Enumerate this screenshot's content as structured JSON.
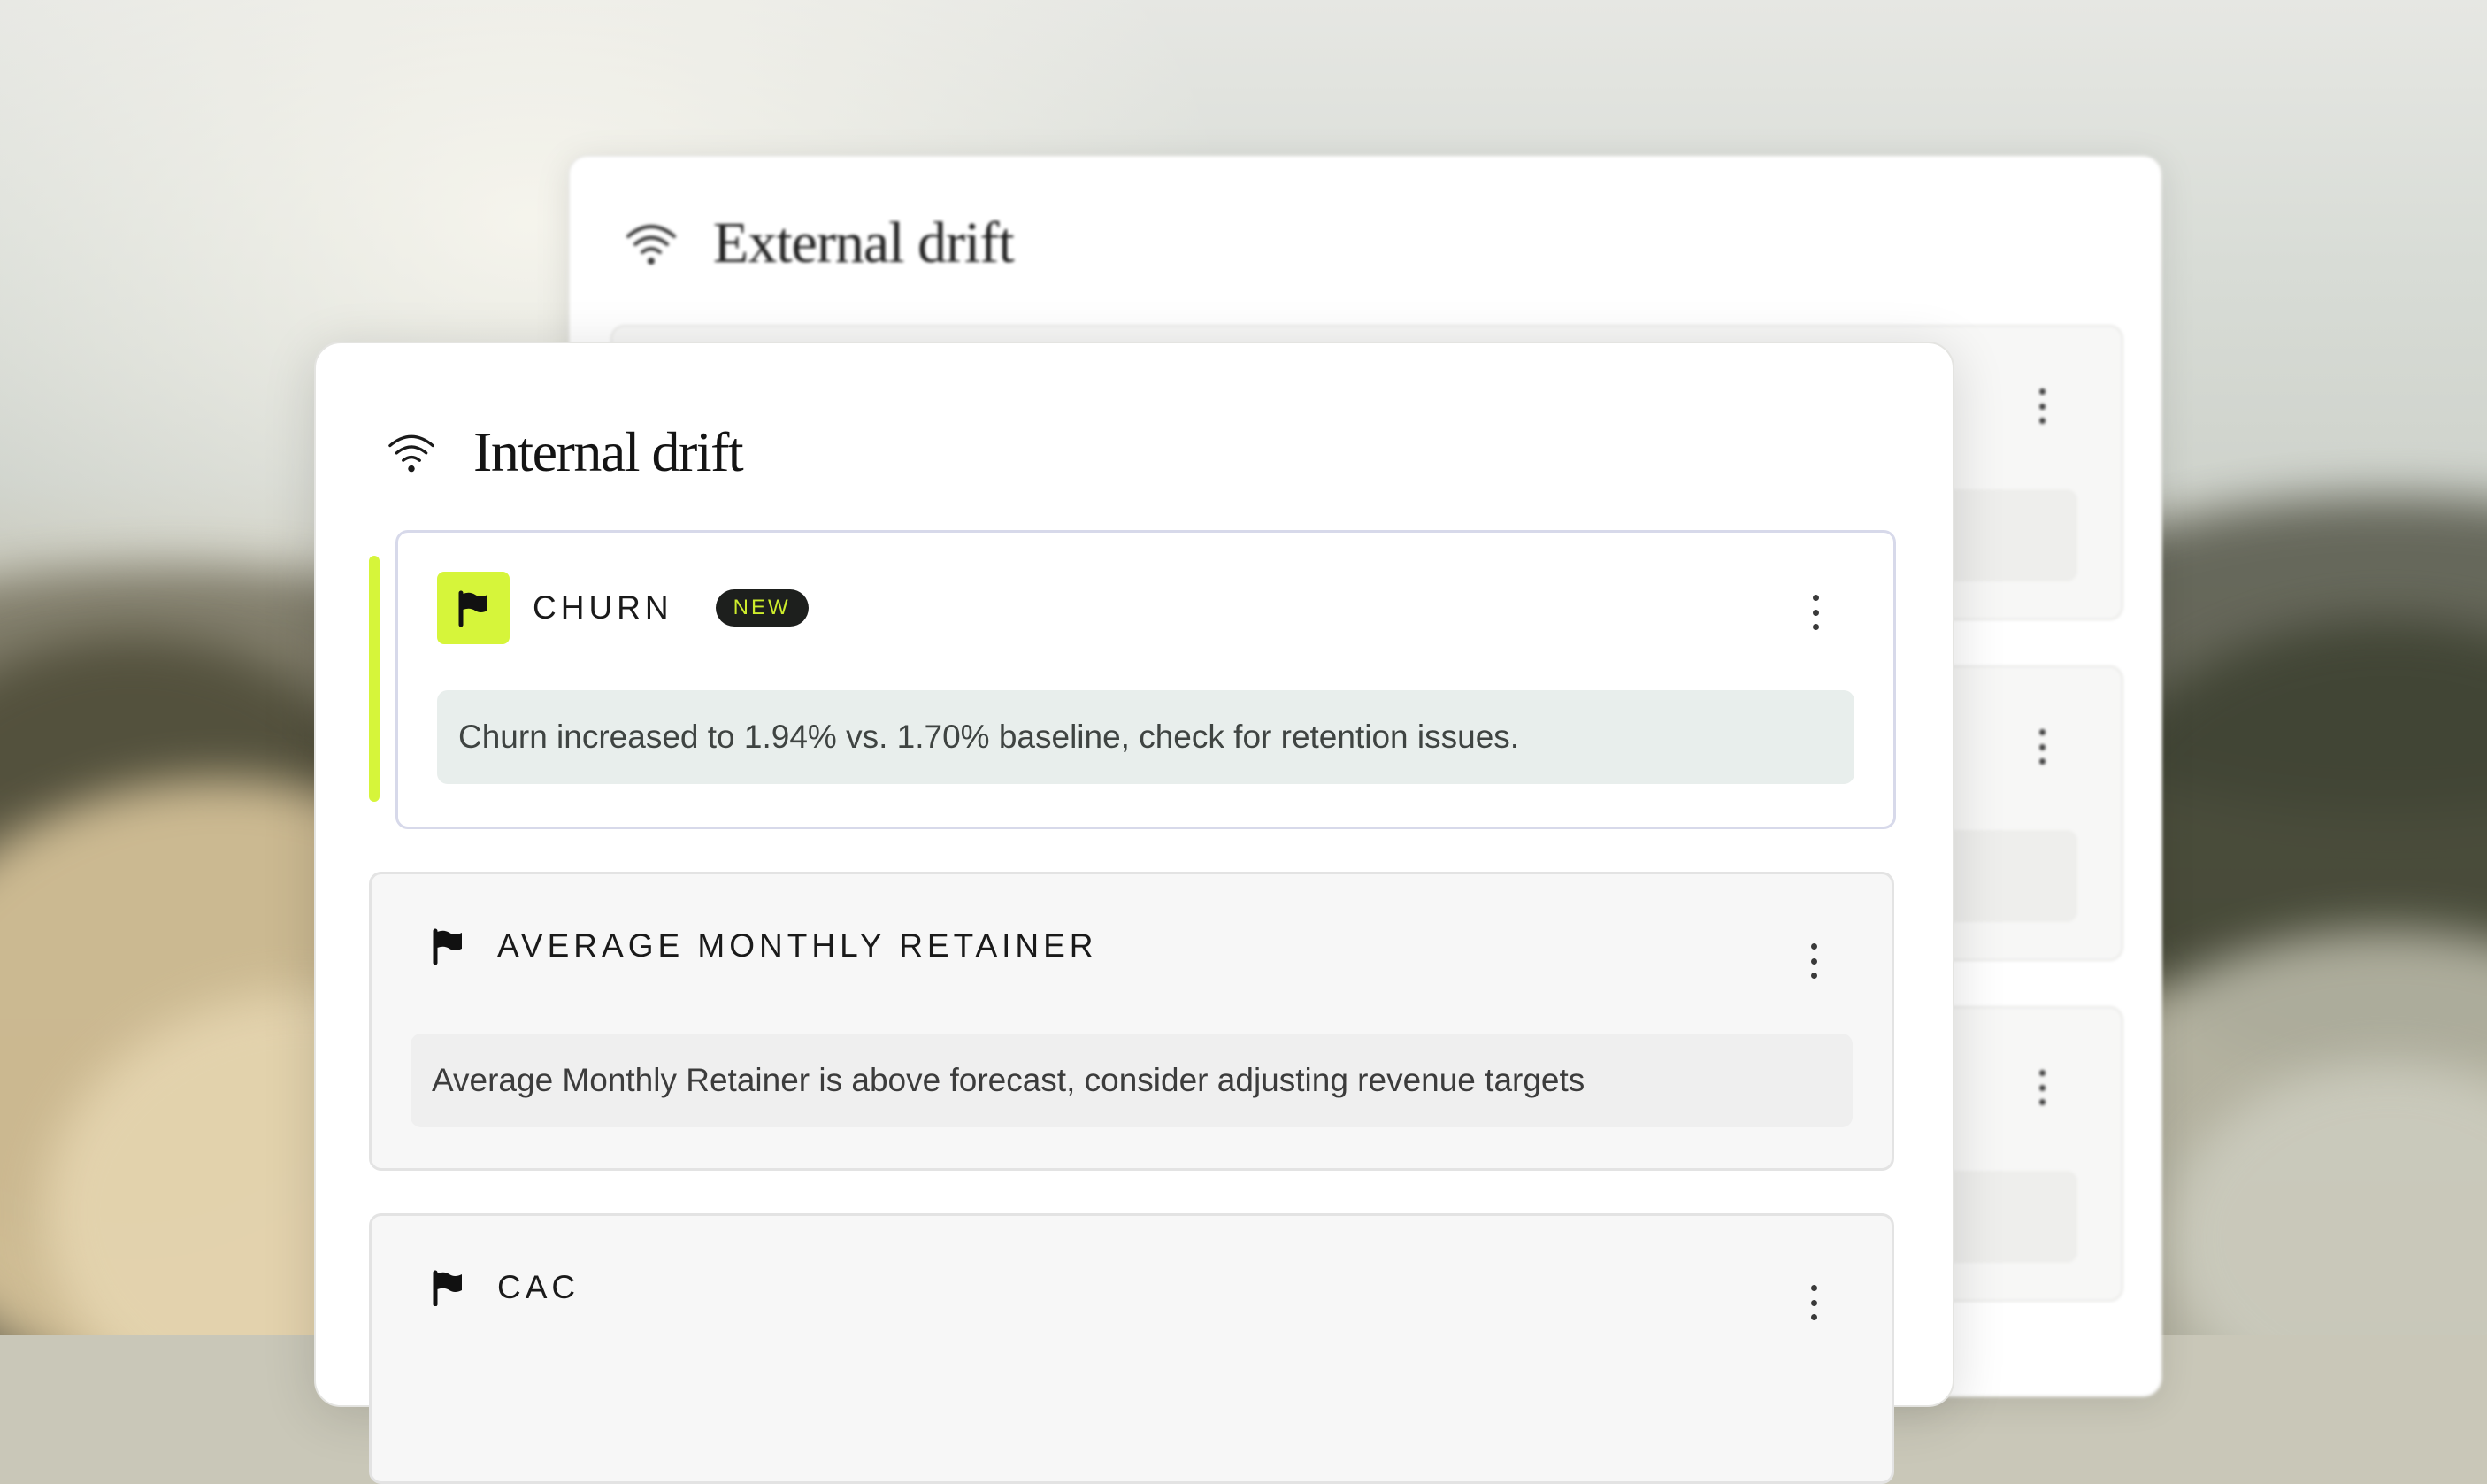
{
  "external_panel": {
    "title": "External drift",
    "icon": "wifi-icon"
  },
  "internal_panel": {
    "title": "Internal drift",
    "icon": "wifi-icon",
    "items": [
      {
        "title": "CHURN",
        "badge": "NEW",
        "icon": "flag-icon",
        "message": "Churn increased to 1.94% vs. 1.70% baseline, check for retention issues.",
        "highlighted": true
      },
      {
        "title": "AVERAGE MONTHLY RETAINER",
        "icon": "flag-icon",
        "message": "Average Monthly Retainer is above forecast, consider adjusting revenue targets"
      },
      {
        "title": "CAC",
        "icon": "flag-icon"
      }
    ]
  },
  "colors": {
    "accent": "#d6f53a",
    "badge_bg": "#1d1f1d",
    "badge_text": "#cdec2c",
    "active_message_bg": "#e8eeec"
  }
}
